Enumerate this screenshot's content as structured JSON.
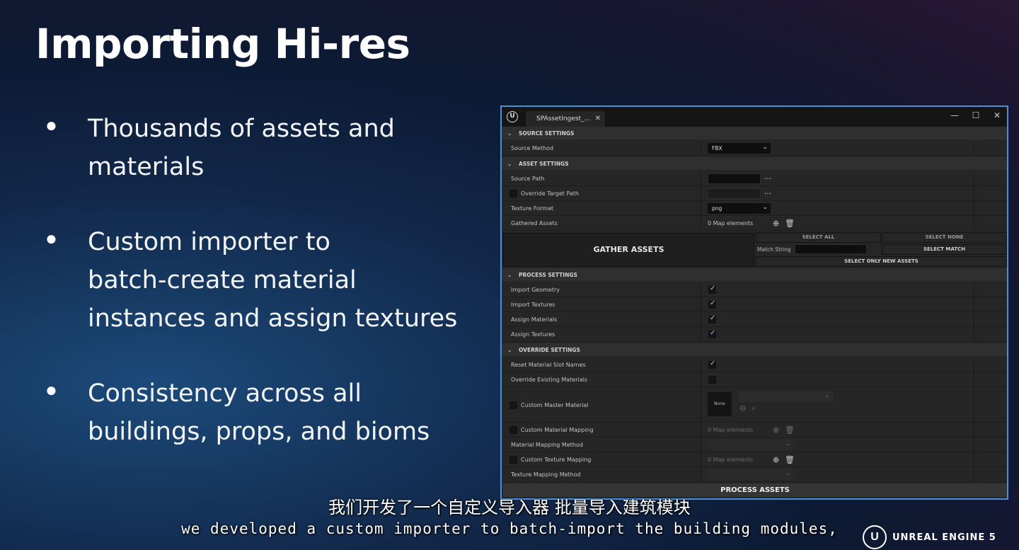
{
  "slide": {
    "title": "Importing Hi-res",
    "bullets": [
      {
        "line1": "Thousands of assets and",
        "line2": "materials"
      },
      {
        "line1": "Custom importer to",
        "line2": "batch-create material",
        "line3": "instances and assign textures"
      },
      {
        "line1": "Consistency across all",
        "line2": "buildings, props, and bioms"
      }
    ]
  },
  "window": {
    "tab_title": "SPAssetIngest_...",
    "sections": {
      "source": "SOURCE SETTINGS",
      "asset": "ASSET SETTINGS",
      "process": "PROCESS SETTINGS",
      "override": "OVERRIDE SETTINGS"
    },
    "source_method": {
      "label": "Source Method",
      "value": "FBX"
    },
    "source_path": {
      "label": "Source Path"
    },
    "override_target_path": {
      "label": "Override Target Path"
    },
    "texture_format": {
      "label": "Texture Format",
      "value": "png"
    },
    "gathered_assets": {
      "label": "Gathered Assets",
      "value": "0 Map elements"
    },
    "gather_button": "GATHER ASSETS",
    "select_all": "SELECT ALL",
    "select_none": "SELECT NONE",
    "match_string_label": "Match String",
    "select_match": "SELECT MATCH",
    "select_only_new": "SELECT ONLY NEW ASSETS",
    "process": {
      "import_geometry": "Import Geometry",
      "import_textures": "Import Textures",
      "assign_materials": "Assign Materials",
      "assign_textures": "Assign Textures"
    },
    "override": {
      "reset_slot_names": "Reset Material Slot Names",
      "override_existing": "Override Existing Materials",
      "custom_master": "Custom Master Material",
      "thumb_none": "None",
      "custom_material_mapping": "Custom Material Mapping",
      "material_mapping_value": "0 Map elements",
      "material_mapping_method": "Material Mapping Method",
      "custom_texture_mapping": "Custom Texture Mapping",
      "texture_mapping_value": "0 Map elements",
      "texture_mapping_method": "Texture Mapping Method"
    },
    "process_button": "PROCESS ASSETS"
  },
  "subtitles": {
    "cn": "我们开发了一个自定义导入器 批量导入建筑模块",
    "en": "we developed a custom importer to batch-import the building modules,"
  },
  "brand": "UNREAL ENGINE 5"
}
